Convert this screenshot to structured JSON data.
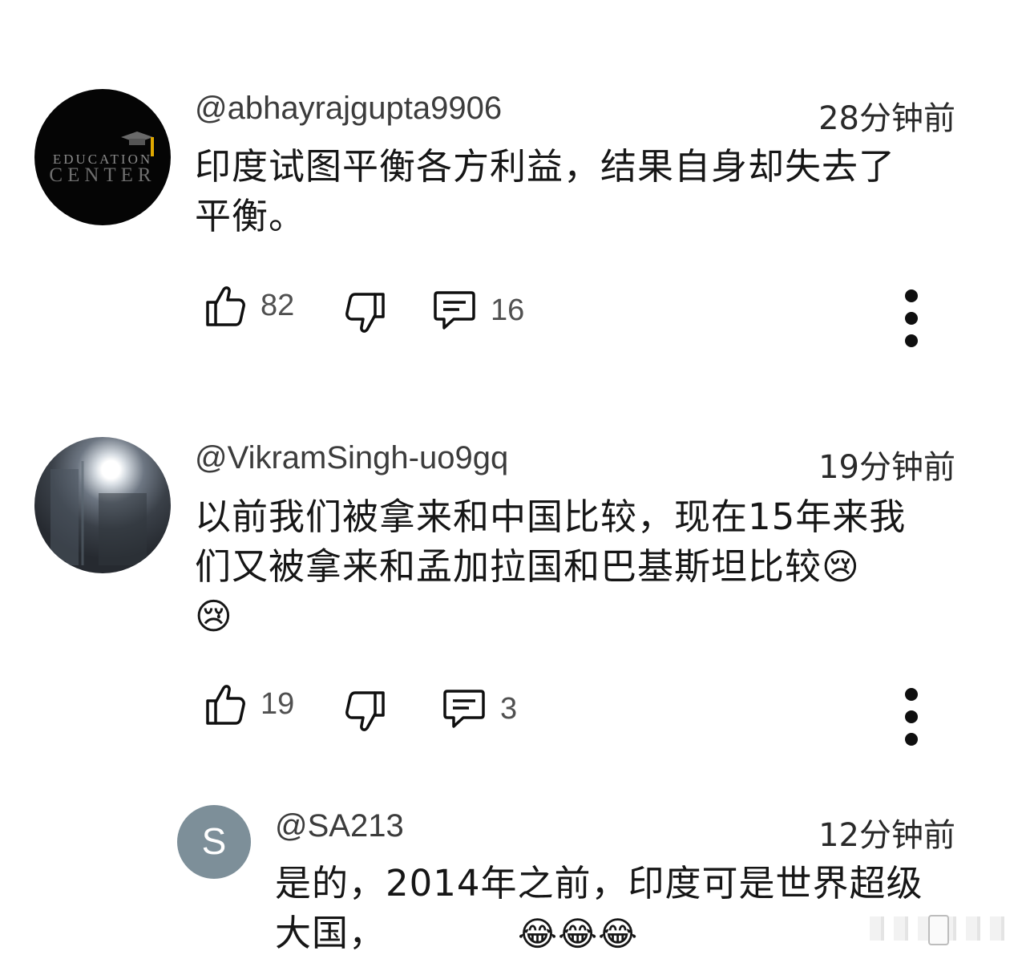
{
  "comments": [
    {
      "author": "@abhayrajgupta9906",
      "time": "28分钟前",
      "lines": [
        "印度试图平衡各方利益，结果自身却失去了",
        "平衡。"
      ],
      "avatar_text": [
        "EDUCATION",
        "CENTER"
      ],
      "likes": "82",
      "replies": "16"
    },
    {
      "author": "@VikramSingh-uo9gq",
      "time": "19分钟前",
      "lines": [
        "以前我们被拿来和中国比较，现在15年来我",
        "们又被拿来和孟加拉国和巴基斯坦比较😢",
        "😢"
      ],
      "likes": "19",
      "replies": "3"
    }
  ],
  "reply": {
    "avatar_letter": "S",
    "avatar_color": "#7d8f99",
    "author": "@SA213",
    "time": "12分钟前",
    "line1": "是的，2014年之前，印度可是世界超级",
    "line2": "大国，",
    "line2_emoji": "😂😂😂"
  },
  "icons": [
    "thumb-up-icon",
    "thumb-down-icon",
    "comment-icon",
    "more-vertical-icon"
  ]
}
